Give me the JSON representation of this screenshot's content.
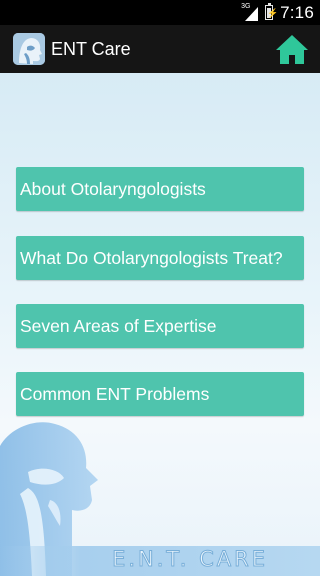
{
  "status_bar": {
    "signal_label": "3G",
    "time": "7:16"
  },
  "header": {
    "title": "ENT Care",
    "app_icon": "head-profile-icon",
    "home_icon": "home-icon",
    "home_color": "#2fc79a"
  },
  "menu": {
    "items": [
      {
        "label": "About Otolaryngologists"
      },
      {
        "label": "What Do Otolaryngologists Treat?"
      },
      {
        "label": "Seven Areas of Expertise"
      },
      {
        "label": "Common ENT Problems"
      }
    ],
    "accent": "#4fc4ad"
  },
  "footer": {
    "logo_text": "E.N.T. CARE"
  }
}
